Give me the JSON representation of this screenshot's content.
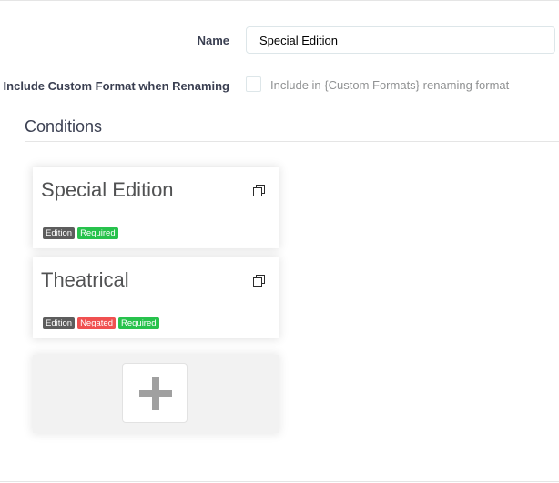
{
  "form": {
    "name_label": "Name",
    "name_value": "Special Edition",
    "include_label": "Include Custom Format when Renaming",
    "include_help": "Include in {Custom Formats} renaming format",
    "include_checked": false
  },
  "conditions": {
    "title": "Conditions",
    "cards": [
      {
        "title": "Special Edition",
        "labels": [
          {
            "text": "Edition",
            "kind": "default"
          },
          {
            "text": "Required",
            "kind": "success"
          }
        ]
      },
      {
        "title": "Theatrical",
        "labels": [
          {
            "text": "Edition",
            "kind": "default"
          },
          {
            "text": "Negated",
            "kind": "danger"
          },
          {
            "text": "Required",
            "kind": "success"
          }
        ]
      }
    ]
  },
  "icons": {
    "clone": "clone-icon",
    "add": "plus-icon"
  },
  "colors": {
    "default_label": "#5d5d5d",
    "success_label": "#27c24c",
    "danger_label": "#f05050"
  }
}
